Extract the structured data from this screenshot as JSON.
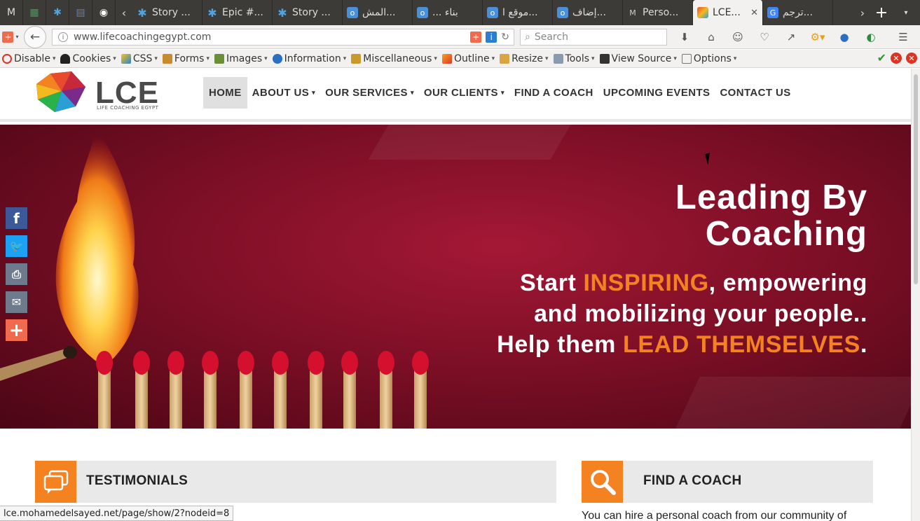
{
  "browser": {
    "tabs": [
      {
        "label": "Story ...",
        "icon": "asterisk-icon"
      },
      {
        "label": "Epic #...",
        "icon": "asterisk-icon"
      },
      {
        "label": "Story ...",
        "icon": "asterisk-icon"
      },
      {
        "label": "المش...",
        "icon": "blue-square-icon"
      },
      {
        "label": "... بناء",
        "icon": "blue-square-icon"
      },
      {
        "label": "موقع ا...",
        "icon": "blue-square-icon"
      },
      {
        "label": "إضاف...",
        "icon": "blue-square-icon"
      },
      {
        "label": "Perso...",
        "icon": "gmail-icon"
      },
      {
        "label": "LCE...",
        "icon": "lce-icon"
      },
      {
        "label": "ترجم...",
        "icon": "translate-icon"
      }
    ],
    "url": "www.lifecoachingegypt.com",
    "search_placeholder": "Search"
  },
  "devtoolbar": {
    "items": [
      "Disable",
      "Cookies",
      "CSS",
      "Forms",
      "Images",
      "Information",
      "Miscellaneous",
      "Outline",
      "Resize",
      "Tools",
      "View Source",
      "Options"
    ]
  },
  "site": {
    "logo_text": "LCE",
    "logo_sub": "LIFE COACHING EGYPT",
    "menu": [
      "HOME",
      "ABOUT US",
      "OUR SERVICES",
      "OUR CLIENTS",
      "FIND A COACH",
      "UPCOMING EVENTS",
      "CONTACT US"
    ],
    "hero": {
      "title_line1": "Leading By",
      "title_line2": "Coaching",
      "l1_pre": "Start ",
      "l1_hl": "INSPIRING",
      "l1_post": ", empowering",
      "l2": "and mobilizing your people..",
      "l3_pre": "Help them ",
      "l3_hl": "LEAD THEMSELVES",
      "l3_post": "."
    },
    "testimonials_title": "TESTIMONIALS",
    "find_coach_title": "FIND A COACH",
    "find_coach_text": "You can hire a personal coach from our community of"
  },
  "status_url": "lce.mohamedelsayed.net/page/show/2?nodeid=8",
  "colors": {
    "accent": "#f58220",
    "hero": "#8b1028",
    "facebook": "#3b5998",
    "twitter": "#1da1f2",
    "print": "#6d7b8d",
    "email": "#6d7b8d",
    "share": "#f06a4e"
  }
}
